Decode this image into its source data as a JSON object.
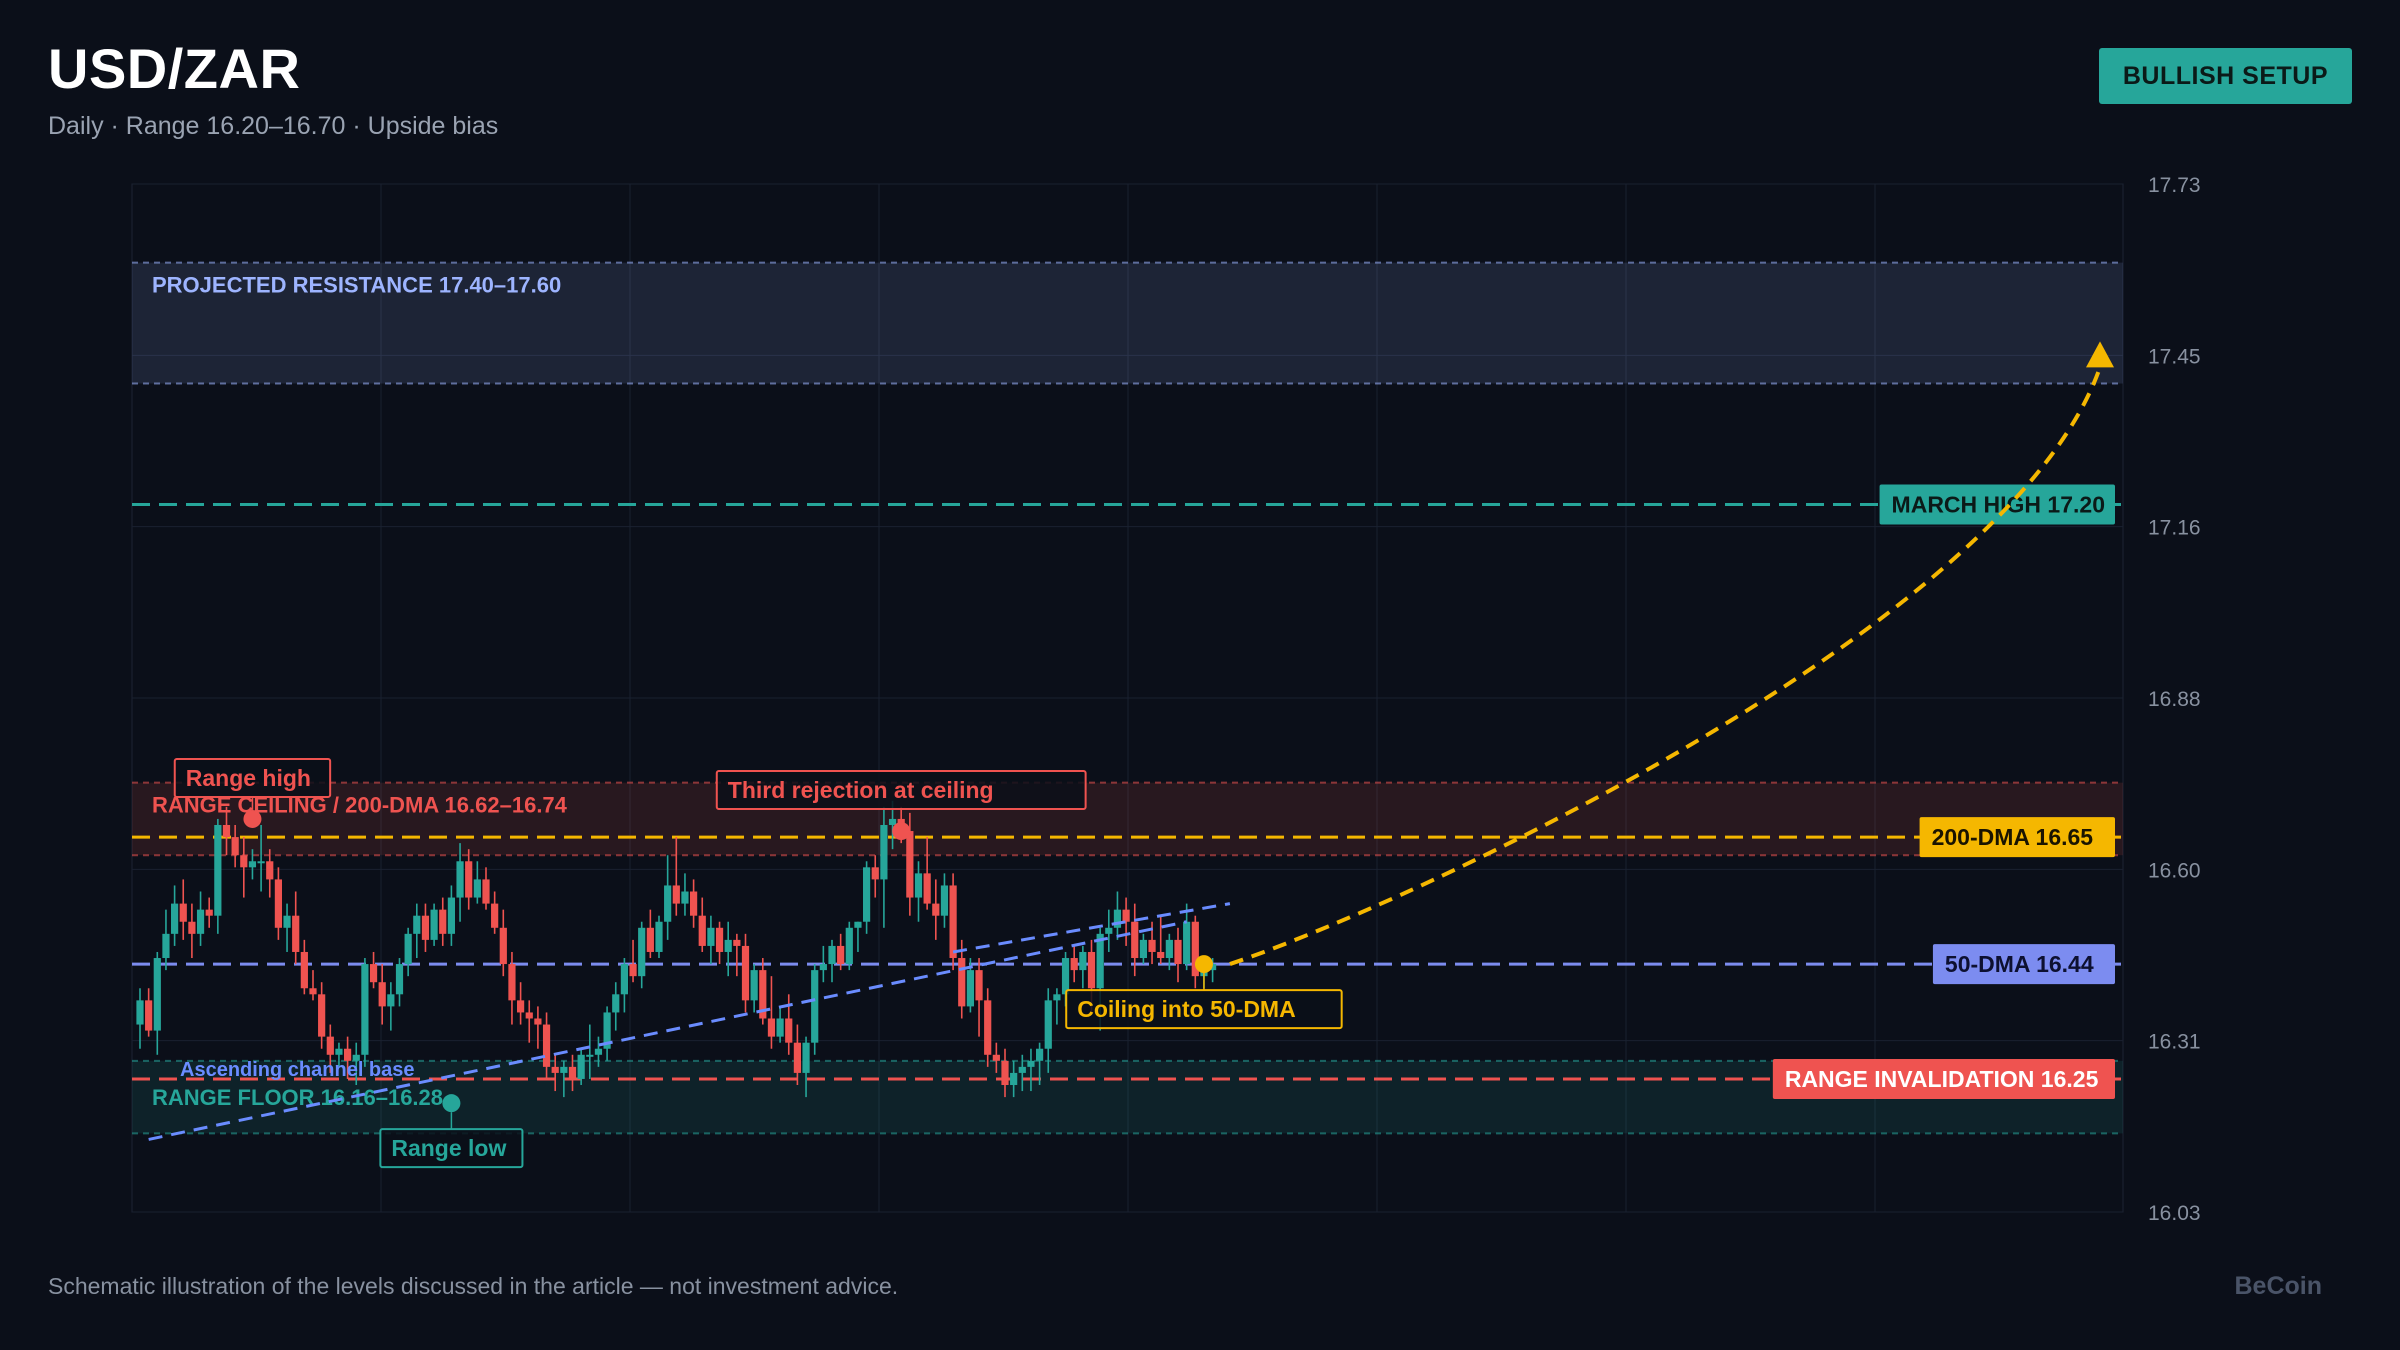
{
  "header": {
    "title": "USD/ZAR",
    "subtitle": "Daily · Range 16.20–16.70 · Upside bias",
    "badge": "BULLISH SETUP"
  },
  "footer": {
    "note": "Schematic illustration of the levels discussed in the article — not investment advice.",
    "brand": "BeCoin"
  },
  "colors": {
    "background": "#0b0f19",
    "up": "#26a69a",
    "down": "#ef5350",
    "dma200": "#f5b700",
    "dma50": "#7c8cf0",
    "resistance": "#9db4ff",
    "march_high": "#26a69a",
    "invalidation": "#ef5350"
  },
  "chart_data": {
    "type": "candlestick",
    "ylim": [
      16.03,
      17.73
    ],
    "yticks": [
      "17.73",
      "17.45",
      "17.16",
      "16.88",
      "16.60",
      "16.31",
      "16.03"
    ],
    "grid": true,
    "candles": [
      {
        "o": 16.34,
        "h": 16.4,
        "l": 16.3,
        "c": 16.38
      },
      {
        "o": 16.38,
        "h": 16.4,
        "l": 16.32,
        "c": 16.33
      },
      {
        "o": 16.33,
        "h": 16.46,
        "l": 16.29,
        "c": 16.45
      },
      {
        "o": 16.45,
        "h": 16.53,
        "l": 16.43,
        "c": 16.49
      },
      {
        "o": 16.49,
        "h": 16.57,
        "l": 16.47,
        "c": 16.54
      },
      {
        "o": 16.54,
        "h": 16.58,
        "l": 16.48,
        "c": 16.51
      },
      {
        "o": 16.51,
        "h": 16.54,
        "l": 16.45,
        "c": 16.49
      },
      {
        "o": 16.49,
        "h": 16.56,
        "l": 16.47,
        "c": 16.53
      },
      {
        "o": 16.53,
        "h": 16.55,
        "l": 16.5,
        "c": 16.52
      },
      {
        "o": 16.52,
        "h": 16.68,
        "l": 16.49,
        "c": 16.67
      },
      {
        "o": 16.67,
        "h": 16.7,
        "l": 16.62,
        "c": 16.65
      },
      {
        "o": 16.65,
        "h": 16.67,
        "l": 16.6,
        "c": 16.62
      },
      {
        "o": 16.62,
        "h": 16.65,
        "l": 16.55,
        "c": 16.6
      },
      {
        "o": 16.6,
        "h": 16.63,
        "l": 16.58,
        "c": 16.61
      },
      {
        "o": 16.61,
        "h": 16.67,
        "l": 16.56,
        "c": 16.61
      },
      {
        "o": 16.61,
        "h": 16.63,
        "l": 16.55,
        "c": 16.58
      },
      {
        "o": 16.58,
        "h": 16.6,
        "l": 16.48,
        "c": 16.5
      },
      {
        "o": 16.5,
        "h": 16.54,
        "l": 16.46,
        "c": 16.52
      },
      {
        "o": 16.52,
        "h": 16.56,
        "l": 16.44,
        "c": 16.46
      },
      {
        "o": 16.46,
        "h": 16.48,
        "l": 16.39,
        "c": 16.4
      },
      {
        "o": 16.4,
        "h": 16.43,
        "l": 16.38,
        "c": 16.39
      },
      {
        "o": 16.39,
        "h": 16.41,
        "l": 16.3,
        "c": 16.32
      },
      {
        "o": 16.32,
        "h": 16.34,
        "l": 16.26,
        "c": 16.29
      },
      {
        "o": 16.29,
        "h": 16.31,
        "l": 16.27,
        "c": 16.3
      },
      {
        "o": 16.3,
        "h": 16.32,
        "l": 16.25,
        "c": 16.28
      },
      {
        "o": 16.28,
        "h": 16.31,
        "l": 16.24,
        "c": 16.29
      },
      {
        "o": 16.29,
        "h": 16.45,
        "l": 16.27,
        "c": 16.44
      },
      {
        "o": 16.44,
        "h": 16.46,
        "l": 16.4,
        "c": 16.41
      },
      {
        "o": 16.41,
        "h": 16.44,
        "l": 16.34,
        "c": 16.37
      },
      {
        "o": 16.37,
        "h": 16.41,
        "l": 16.33,
        "c": 16.39
      },
      {
        "o": 16.39,
        "h": 16.45,
        "l": 16.37,
        "c": 16.44
      },
      {
        "o": 16.44,
        "h": 16.5,
        "l": 16.42,
        "c": 16.49
      },
      {
        "o": 16.49,
        "h": 16.54,
        "l": 16.45,
        "c": 16.52
      },
      {
        "o": 16.52,
        "h": 16.54,
        "l": 16.46,
        "c": 16.48
      },
      {
        "o": 16.48,
        "h": 16.54,
        "l": 16.47,
        "c": 16.53
      },
      {
        "o": 16.53,
        "h": 16.55,
        "l": 16.47,
        "c": 16.49
      },
      {
        "o": 16.49,
        "h": 16.57,
        "l": 16.47,
        "c": 16.55
      },
      {
        "o": 16.55,
        "h": 16.64,
        "l": 16.51,
        "c": 16.61
      },
      {
        "o": 16.61,
        "h": 16.63,
        "l": 16.53,
        "c": 16.55
      },
      {
        "o": 16.55,
        "h": 16.61,
        "l": 16.54,
        "c": 16.58
      },
      {
        "o": 16.58,
        "h": 16.6,
        "l": 16.53,
        "c": 16.54
      },
      {
        "o": 16.54,
        "h": 16.56,
        "l": 16.49,
        "c": 16.5
      },
      {
        "o": 16.5,
        "h": 16.53,
        "l": 16.42,
        "c": 16.44
      },
      {
        "o": 16.44,
        "h": 16.46,
        "l": 16.34,
        "c": 16.38
      },
      {
        "o": 16.38,
        "h": 16.41,
        "l": 16.34,
        "c": 16.36
      },
      {
        "o": 16.36,
        "h": 16.38,
        "l": 16.31,
        "c": 16.35
      },
      {
        "o": 16.35,
        "h": 16.37,
        "l": 16.3,
        "c": 16.34
      },
      {
        "o": 16.34,
        "h": 16.36,
        "l": 16.25,
        "c": 16.27
      },
      {
        "o": 16.27,
        "h": 16.29,
        "l": 16.23,
        "c": 16.26
      },
      {
        "o": 16.26,
        "h": 16.28,
        "l": 16.22,
        "c": 16.27
      },
      {
        "o": 16.27,
        "h": 16.29,
        "l": 16.23,
        "c": 16.25
      },
      {
        "o": 16.25,
        "h": 16.3,
        "l": 16.24,
        "c": 16.29
      },
      {
        "o": 16.29,
        "h": 16.34,
        "l": 16.25,
        "c": 16.29
      },
      {
        "o": 16.29,
        "h": 16.32,
        "l": 16.27,
        "c": 16.3
      },
      {
        "o": 16.3,
        "h": 16.37,
        "l": 16.28,
        "c": 16.36
      },
      {
        "o": 16.36,
        "h": 16.41,
        "l": 16.33,
        "c": 16.39
      },
      {
        "o": 16.39,
        "h": 16.45,
        "l": 16.36,
        "c": 16.44
      },
      {
        "o": 16.44,
        "h": 16.48,
        "l": 16.41,
        "c": 16.42
      },
      {
        "o": 16.42,
        "h": 16.51,
        "l": 16.4,
        "c": 16.5
      },
      {
        "o": 16.5,
        "h": 16.53,
        "l": 16.45,
        "c": 16.46
      },
      {
        "o": 16.46,
        "h": 16.52,
        "l": 16.45,
        "c": 16.51
      },
      {
        "o": 16.51,
        "h": 16.62,
        "l": 16.48,
        "c": 16.57
      },
      {
        "o": 16.57,
        "h": 16.65,
        "l": 16.52,
        "c": 16.54
      },
      {
        "o": 16.54,
        "h": 16.59,
        "l": 16.52,
        "c": 16.56
      },
      {
        "o": 16.56,
        "h": 16.58,
        "l": 16.5,
        "c": 16.52
      },
      {
        "o": 16.52,
        "h": 16.55,
        "l": 16.46,
        "c": 16.47
      },
      {
        "o": 16.47,
        "h": 16.52,
        "l": 16.44,
        "c": 16.5
      },
      {
        "o": 16.5,
        "h": 16.51,
        "l": 16.44,
        "c": 16.46
      },
      {
        "o": 16.46,
        "h": 16.51,
        "l": 16.42,
        "c": 16.48
      },
      {
        "o": 16.48,
        "h": 16.49,
        "l": 16.42,
        "c": 16.47
      },
      {
        "o": 16.47,
        "h": 16.49,
        "l": 16.36,
        "c": 16.38
      },
      {
        "o": 16.38,
        "h": 16.44,
        "l": 16.36,
        "c": 16.43
      },
      {
        "o": 16.43,
        "h": 16.45,
        "l": 16.34,
        "c": 16.35
      },
      {
        "o": 16.35,
        "h": 16.42,
        "l": 16.3,
        "c": 16.32
      },
      {
        "o": 16.32,
        "h": 16.37,
        "l": 16.31,
        "c": 16.35
      },
      {
        "o": 16.35,
        "h": 16.39,
        "l": 16.29,
        "c": 16.31
      },
      {
        "o": 16.31,
        "h": 16.34,
        "l": 16.24,
        "c": 16.26
      },
      {
        "o": 16.26,
        "h": 16.32,
        "l": 16.22,
        "c": 16.31
      },
      {
        "o": 16.31,
        "h": 16.44,
        "l": 16.29,
        "c": 16.43
      },
      {
        "o": 16.43,
        "h": 16.47,
        "l": 16.41,
        "c": 16.44
      },
      {
        "o": 16.44,
        "h": 16.48,
        "l": 16.41,
        "c": 16.47
      },
      {
        "o": 16.47,
        "h": 16.49,
        "l": 16.43,
        "c": 16.44
      },
      {
        "o": 16.44,
        "h": 16.51,
        "l": 16.43,
        "c": 16.5
      },
      {
        "o": 16.5,
        "h": 16.51,
        "l": 16.46,
        "c": 16.51
      },
      {
        "o": 16.51,
        "h": 16.61,
        "l": 16.49,
        "c": 16.6
      },
      {
        "o": 16.6,
        "h": 16.62,
        "l": 16.55,
        "c": 16.58
      },
      {
        "o": 16.58,
        "h": 16.7,
        "l": 16.5,
        "c": 16.67
      },
      {
        "o": 16.67,
        "h": 16.71,
        "l": 16.63,
        "c": 16.68
      },
      {
        "o": 16.68,
        "h": 16.7,
        "l": 16.64,
        "c": 16.66
      },
      {
        "o": 16.66,
        "h": 16.69,
        "l": 16.52,
        "c": 16.55
      },
      {
        "o": 16.55,
        "h": 16.61,
        "l": 16.51,
        "c": 16.59
      },
      {
        "o": 16.59,
        "h": 16.65,
        "l": 16.53,
        "c": 16.54
      },
      {
        "o": 16.54,
        "h": 16.58,
        "l": 16.48,
        "c": 16.52
      },
      {
        "o": 16.52,
        "h": 16.59,
        "l": 16.5,
        "c": 16.57
      },
      {
        "o": 16.57,
        "h": 16.59,
        "l": 16.43,
        "c": 16.45
      },
      {
        "o": 16.45,
        "h": 16.48,
        "l": 16.35,
        "c": 16.37
      },
      {
        "o": 16.37,
        "h": 16.45,
        "l": 16.36,
        "c": 16.43
      },
      {
        "o": 16.43,
        "h": 16.45,
        "l": 16.32,
        "c": 16.38
      },
      {
        "o": 16.38,
        "h": 16.4,
        "l": 16.27,
        "c": 16.29
      },
      {
        "o": 16.29,
        "h": 16.31,
        "l": 16.26,
        "c": 16.28
      },
      {
        "o": 16.28,
        "h": 16.3,
        "l": 16.22,
        "c": 16.24
      },
      {
        "o": 16.24,
        "h": 16.28,
        "l": 16.22,
        "c": 16.26
      },
      {
        "o": 16.26,
        "h": 16.29,
        "l": 16.23,
        "c": 16.27
      },
      {
        "o": 16.27,
        "h": 16.3,
        "l": 16.23,
        "c": 16.28
      },
      {
        "o": 16.28,
        "h": 16.31,
        "l": 16.24,
        "c": 16.3
      },
      {
        "o": 16.3,
        "h": 16.4,
        "l": 16.26,
        "c": 16.38
      },
      {
        "o": 16.38,
        "h": 16.4,
        "l": 16.34,
        "c": 16.39
      },
      {
        "o": 16.39,
        "h": 16.46,
        "l": 16.37,
        "c": 16.45
      },
      {
        "o": 16.45,
        "h": 16.47,
        "l": 16.41,
        "c": 16.43
      },
      {
        "o": 16.43,
        "h": 16.47,
        "l": 16.4,
        "c": 16.46
      },
      {
        "o": 16.46,
        "h": 16.48,
        "l": 16.36,
        "c": 16.4
      },
      {
        "o": 16.4,
        "h": 16.5,
        "l": 16.33,
        "c": 16.49
      },
      {
        "o": 16.49,
        "h": 16.53,
        "l": 16.46,
        "c": 16.5
      },
      {
        "o": 16.5,
        "h": 16.56,
        "l": 16.48,
        "c": 16.53
      },
      {
        "o": 16.53,
        "h": 16.55,
        "l": 16.47,
        "c": 16.51
      },
      {
        "o": 16.51,
        "h": 16.54,
        "l": 16.42,
        "c": 16.45
      },
      {
        "o": 16.45,
        "h": 16.49,
        "l": 16.44,
        "c": 16.48
      },
      {
        "o": 16.48,
        "h": 16.51,
        "l": 16.44,
        "c": 16.46
      },
      {
        "o": 16.46,
        "h": 16.52,
        "l": 16.44,
        "c": 16.45
      },
      {
        "o": 16.45,
        "h": 16.49,
        "l": 16.43,
        "c": 16.48
      },
      {
        "o": 16.48,
        "h": 16.5,
        "l": 16.41,
        "c": 16.44
      },
      {
        "o": 16.44,
        "h": 16.54,
        "l": 16.43,
        "c": 16.51
      },
      {
        "o": 16.51,
        "h": 16.52,
        "l": 16.4,
        "c": 16.42
      },
      {
        "o": 16.42,
        "h": 16.44,
        "l": 16.4,
        "c": 16.43
      },
      {
        "o": 16.43,
        "h": 16.45,
        "l": 16.41,
        "c": 16.44
      }
    ],
    "zones": [
      {
        "label": "PROJECTED RESISTANCE 17.40–17.60",
        "from": 17.4,
        "to": 17.6,
        "color": "#9db4ff"
      },
      {
        "label": "RANGE CEILING / 200-DMA 16.62–16.74",
        "from": 16.62,
        "to": 16.74,
        "color": "#ef5350"
      },
      {
        "label": "RANGE FLOOR 16.16–16.28",
        "from": 16.16,
        "to": 16.28,
        "color": "#26a69a"
      }
    ],
    "levels": [
      {
        "label": "MARCH HIGH 17.20",
        "value": 17.2,
        "color": "#26a69a",
        "text_color": "#0b1a18"
      },
      {
        "label": "200-DMA 16.65",
        "value": 16.65,
        "color": "#f5b700",
        "text_color": "#1a1400"
      },
      {
        "label": "50-DMA 16.44",
        "value": 16.44,
        "color": "#7c8cf0",
        "text_color": "#0d1030"
      },
      {
        "label": "RANGE INVALIDATION 16.25",
        "value": 16.25,
        "color": "#ef5350",
        "text_color": "#ffffff"
      }
    ],
    "trendline": {
      "label": "Ascending channel base",
      "from_index": 1,
      "from_value": 16.15,
      "to_index": 121,
      "to_value": 16.51
    },
    "channel_top": {
      "from_index": 94,
      "from_value": 16.46,
      "to_index": 126,
      "to_value": 16.54
    },
    "projection": {
      "from_index": 126,
      "from_value": 16.44,
      "to_value": 17.45,
      "bars_ahead": 18
    },
    "annotations": [
      {
        "text": "Range high",
        "index": 13,
        "value": 16.68,
        "color": "#ef5350",
        "position": "above"
      },
      {
        "text": "Third rejection at ceiling",
        "index": 88,
        "value": 16.66,
        "color": "#ef5350",
        "position": "above"
      },
      {
        "text": "Range low",
        "index": 36,
        "value": 16.21,
        "color": "#26a69a",
        "position": "below"
      },
      {
        "text": "Coiling into 50-DMA",
        "index": 123,
        "value": 16.44,
        "color": "#f5b700",
        "position": "below"
      }
    ]
  }
}
